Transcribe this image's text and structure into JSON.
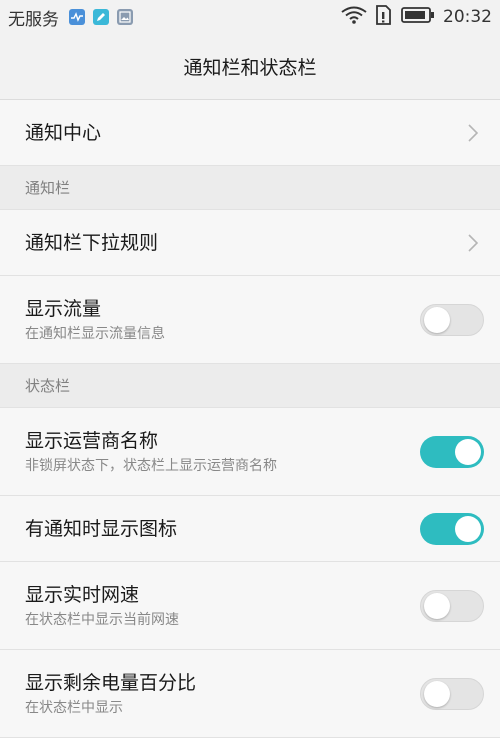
{
  "status_bar": {
    "carrier": "无服务",
    "time": "20:32",
    "icons": [
      "health-app-icon",
      "notes-app-icon",
      "gallery-app-icon",
      "wifi-icon",
      "sim-card-icon",
      "battery-icon"
    ]
  },
  "header": {
    "title": "通知栏和状态栏"
  },
  "items": {
    "notification_center": {
      "title": "通知中心"
    },
    "section_notification": {
      "label": "通知栏"
    },
    "pull_down_rules": {
      "title": "通知栏下拉规则"
    },
    "show_traffic": {
      "title": "显示流量",
      "subtitle": "在通知栏显示流量信息",
      "enabled": false
    },
    "section_status": {
      "label": "状态栏"
    },
    "show_carrier": {
      "title": "显示运营商名称",
      "subtitle": "非锁屏状态下，状态栏上显示运营商名称",
      "enabled": true
    },
    "show_icons": {
      "title": "有通知时显示图标",
      "enabled": true
    },
    "show_speed": {
      "title": "显示实时网速",
      "subtitle": "在状态栏中显示当前网速",
      "enabled": false
    },
    "show_battery": {
      "title": "显示剩余电量百分比",
      "subtitle": "在状态栏中显示",
      "enabled": false
    }
  },
  "colors": {
    "toggle_on": "#2ebcc0",
    "toggle_off": "#e4e4e4",
    "background": "#f2f2f2"
  }
}
